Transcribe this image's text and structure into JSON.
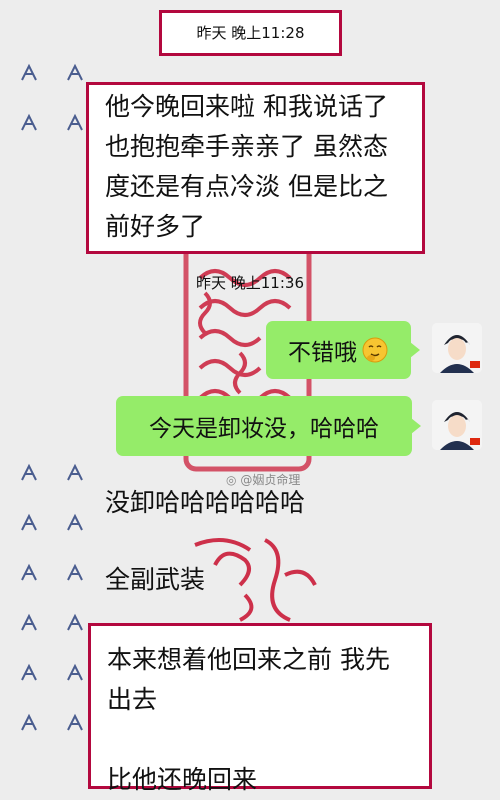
{
  "timestamps": {
    "first": "昨天 晚上11:28",
    "second": "昨天 晚上11:36"
  },
  "messages": {
    "m1": [
      "他今晚回来啦 和我说话了",
      "也抱抱牵手亲亲了 虽然态",
      "度还是有点冷淡 但是比之",
      "前好多了"
    ],
    "m2": "不错哦",
    "m3": "今天是卸妆没，哈哈哈",
    "m4": "没卸哈哈哈哈哈哈",
    "m5": "全副武装",
    "m6": [
      "本来想着他回来之前 我先",
      "出去",
      "",
      "比他还晚回来"
    ]
  },
  "watermark": "@姻贞命理",
  "colors": {
    "frame": "#b3083e",
    "bubble": "#95ec69",
    "seal": "#c8102e"
  }
}
